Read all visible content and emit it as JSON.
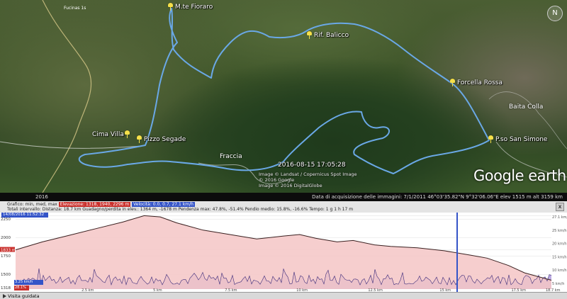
{
  "map": {
    "places": [
      {
        "id": "mte-fioraro",
        "label": "M.te Fioraro"
      },
      {
        "id": "rif-balicco",
        "label": "Rif. Balicco"
      },
      {
        "id": "forcella-rossa",
        "label": "Forcella Rossa"
      },
      {
        "id": "pso-san-simone",
        "label": "P.so San Simone"
      },
      {
        "id": "cima-villa",
        "label": "Cima Villa"
      },
      {
        "id": "pizzo-segade",
        "label": "Pizzo Segade"
      }
    ],
    "map_labels": {
      "baita_colla": "Baita Colla",
      "fraccia": "Fraccia",
      "scale": "Fucinas 1s"
    },
    "timestamp": "2016-08-15 17:05:28",
    "credits": [
      "Image © Landsat / Copernicus Spot Image",
      "© 2016 Google",
      "Image © 2016 DigitalGlobe"
    ],
    "logo": {
      "google": "Google",
      "earth": "earth"
    },
    "compass": "N",
    "colors": {
      "track": "#6aa8e6",
      "pin": "#f5e04a"
    }
  },
  "statusbar": {
    "left": "2016",
    "right": "Data di acquisizione delle immagini: 7/1/2011     46°03'35.82\"N  9°32'06.06\"E  elev 1515 m     alt 3159 km"
  },
  "profile_header": {
    "row1_prefix": "Grafico: min, med, max",
    "elev_label": "Elevazione: 1318, 1940, 2296 m",
    "speed_label": "Velocità: 0.0, 0.7, 27.1 km/h",
    "row2": "Totali intervallo:  Distanza: 18.7 km   Guadagno/perdita in elev.: 1364 m, -1678 m          Pendenza max: 47.8%, -51.4%   Pendio medio: 15.8%, -16.6%   Tempo: 1 g 1 h 17 m",
    "close": "x"
  },
  "profile": {
    "date": "14/08/2016 11:52:32",
    "y_left": [
      "2296 m",
      "2250",
      "2000",
      "1833 m",
      "1750",
      "1500",
      "1318"
    ],
    "y_right": [
      "27.1 km/h",
      "25 km/h",
      "20 km/h",
      "15 km/h",
      "10 km/h",
      "5 km/h"
    ],
    "x_ticks": [
      "2.5 km",
      "5 km",
      "7.5 km",
      "10 km",
      "12.5 km",
      "15 km",
      "17.5 km",
      "18.7 km"
    ],
    "cursor_speed": "3.25 km/h",
    "cursor_slope": "28.1%",
    "colors": {
      "elev_fill": "#f4c6c6",
      "elev_line": "#3a2020",
      "speed_fill": "#b6a2e0",
      "speed_line": "#3b2a7a",
      "cursor": "#3454c8",
      "left_marker": "#c9302c"
    }
  },
  "bottom": {
    "tour_label": "Visita guidata"
  }
}
